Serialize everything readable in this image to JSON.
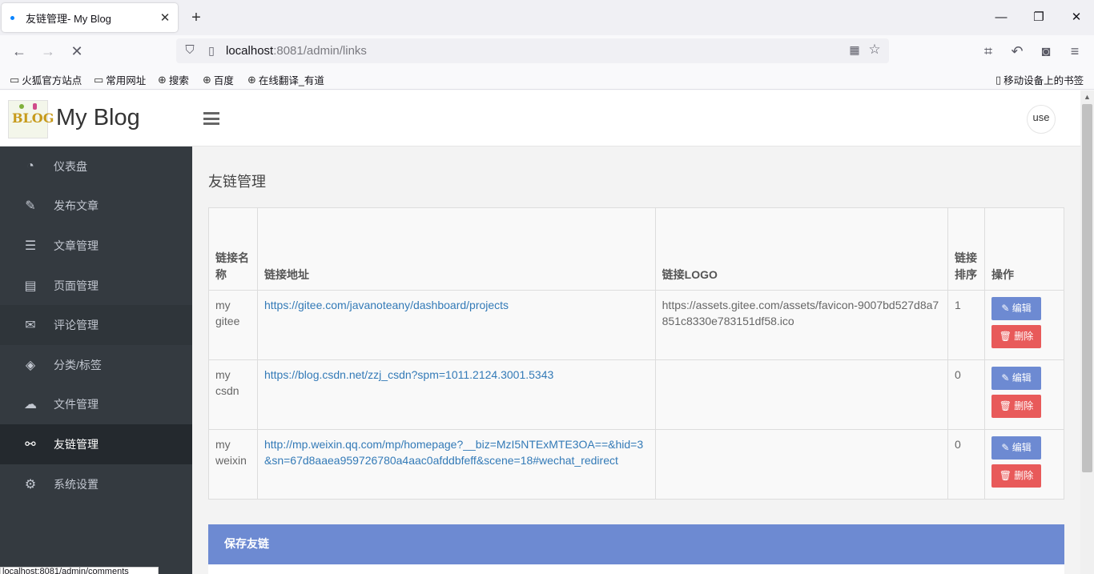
{
  "browser": {
    "tab_title": "友链管理- My Blog",
    "tab_close": "✕",
    "new_tab": "+",
    "win_min": "—",
    "win_max": "❐",
    "win_close": "✕",
    "url_host": "localhost",
    "url_path": ":8081/admin/links",
    "icons": {
      "back": "←",
      "forward": "→",
      "stop": "✕",
      "shield": "⛉",
      "page": "▯",
      "qr": "▦",
      "star": "☆",
      "crop": "⌗",
      "undo": "↶",
      "ext": "◙",
      "menu": "≡"
    },
    "bookmarks": [
      {
        "icon": "▭",
        "label": "火狐官方站点"
      },
      {
        "icon": "▭",
        "label": "常用网址"
      },
      {
        "icon": "⊕",
        "label": "搜索"
      },
      {
        "icon": "⊕",
        "label": "百度"
      },
      {
        "icon": "⊕",
        "label": "在线翻译_有道"
      }
    ],
    "mobile_bookmarks": "移动设备上的书签",
    "status_text": "localhost:8081/admin/comments"
  },
  "sidebar": {
    "brand": "My Blog",
    "logo_text": "BLOG",
    "items": [
      {
        "icon": "◔",
        "label": "仪表盘"
      },
      {
        "icon": "✎",
        "label": "发布文章"
      },
      {
        "icon": "☰",
        "label": "文章管理"
      },
      {
        "icon": "▤",
        "label": "页面管理"
      },
      {
        "icon": "✉",
        "label": "评论管理"
      },
      {
        "icon": "◈",
        "label": "分类/标签"
      },
      {
        "icon": "☁",
        "label": "文件管理"
      },
      {
        "icon": "⚯",
        "label": "友链管理"
      },
      {
        "icon": "⚙",
        "label": "系统设置"
      }
    ]
  },
  "topbar": {
    "user": "use"
  },
  "page": {
    "title": "友链管理",
    "table": {
      "headers": [
        "链接名称",
        "链接地址",
        "链接LOGO",
        "链接排序",
        "操作"
      ],
      "rows": [
        {
          "name": "my gitee",
          "url": "https://gitee.com/javanoteany/dashboard/projects",
          "logo": "https://assets.gitee.com/assets/favicon-9007bd527d8a7851c8330e783151df58.ico",
          "sort": "1"
        },
        {
          "name": "my csdn",
          "url": "https://blog.csdn.net/zzj_csdn?spm=1011.2124.3001.5343",
          "logo": "",
          "sort": "0"
        },
        {
          "name": "my weixin",
          "url": "http://mp.weixin.qq.com/mp/homepage?__biz=MzI5NTExMTE3OA==&hid=3&sn=67d8aaea959726780a4aac0afddbfeff&scene=18#wechat_redirect",
          "logo": "",
          "sort": "0"
        }
      ],
      "edit_label": "✎ 编辑",
      "delete_label": "🗑 删除"
    },
    "panel_title": "保存友链"
  },
  "scrollbar": {
    "up": "▲"
  }
}
